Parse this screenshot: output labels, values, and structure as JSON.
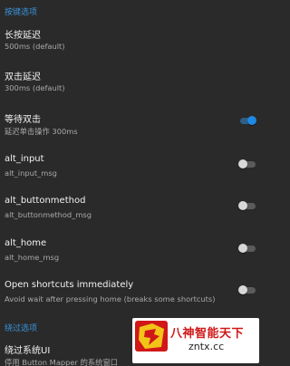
{
  "sections": [
    {
      "header": "按键选项"
    },
    {
      "header": "绕过选项"
    }
  ],
  "prefs": {
    "long_press": {
      "title": "长按延迟",
      "summary": "500ms (default)"
    },
    "double_tap": {
      "title": "双击延迟",
      "summary": "300ms (default)"
    },
    "wait_double": {
      "title": "等待双击",
      "summary": "延迟单击操作 300ms",
      "enabled": true
    },
    "alt_input": {
      "title": "alt_input",
      "summary": "alt_input_msg",
      "enabled": false
    },
    "alt_buttonmethod": {
      "title": "alt_buttonmethod",
      "summary": "alt_buttonmethod_msg",
      "enabled": false
    },
    "alt_home": {
      "title": "alt_home",
      "summary": "alt_home_msg",
      "enabled": false
    },
    "open_shortcuts": {
      "title": "Open shortcuts immediately",
      "summary": "Avoid wait after pressing home (breaks some shortcuts)",
      "enabled": false
    },
    "bypass_system": {
      "title": "绕过系统UI",
      "summary": "停用 Button Mapper 的系统窗口",
      "enabled": false
    }
  },
  "watermark": {
    "title": "八神智能天下",
    "url": "zntx.cc"
  },
  "colors": {
    "background": "#2a2a2a",
    "accent": "#1e88e5",
    "section_header": "#3a92d8"
  }
}
